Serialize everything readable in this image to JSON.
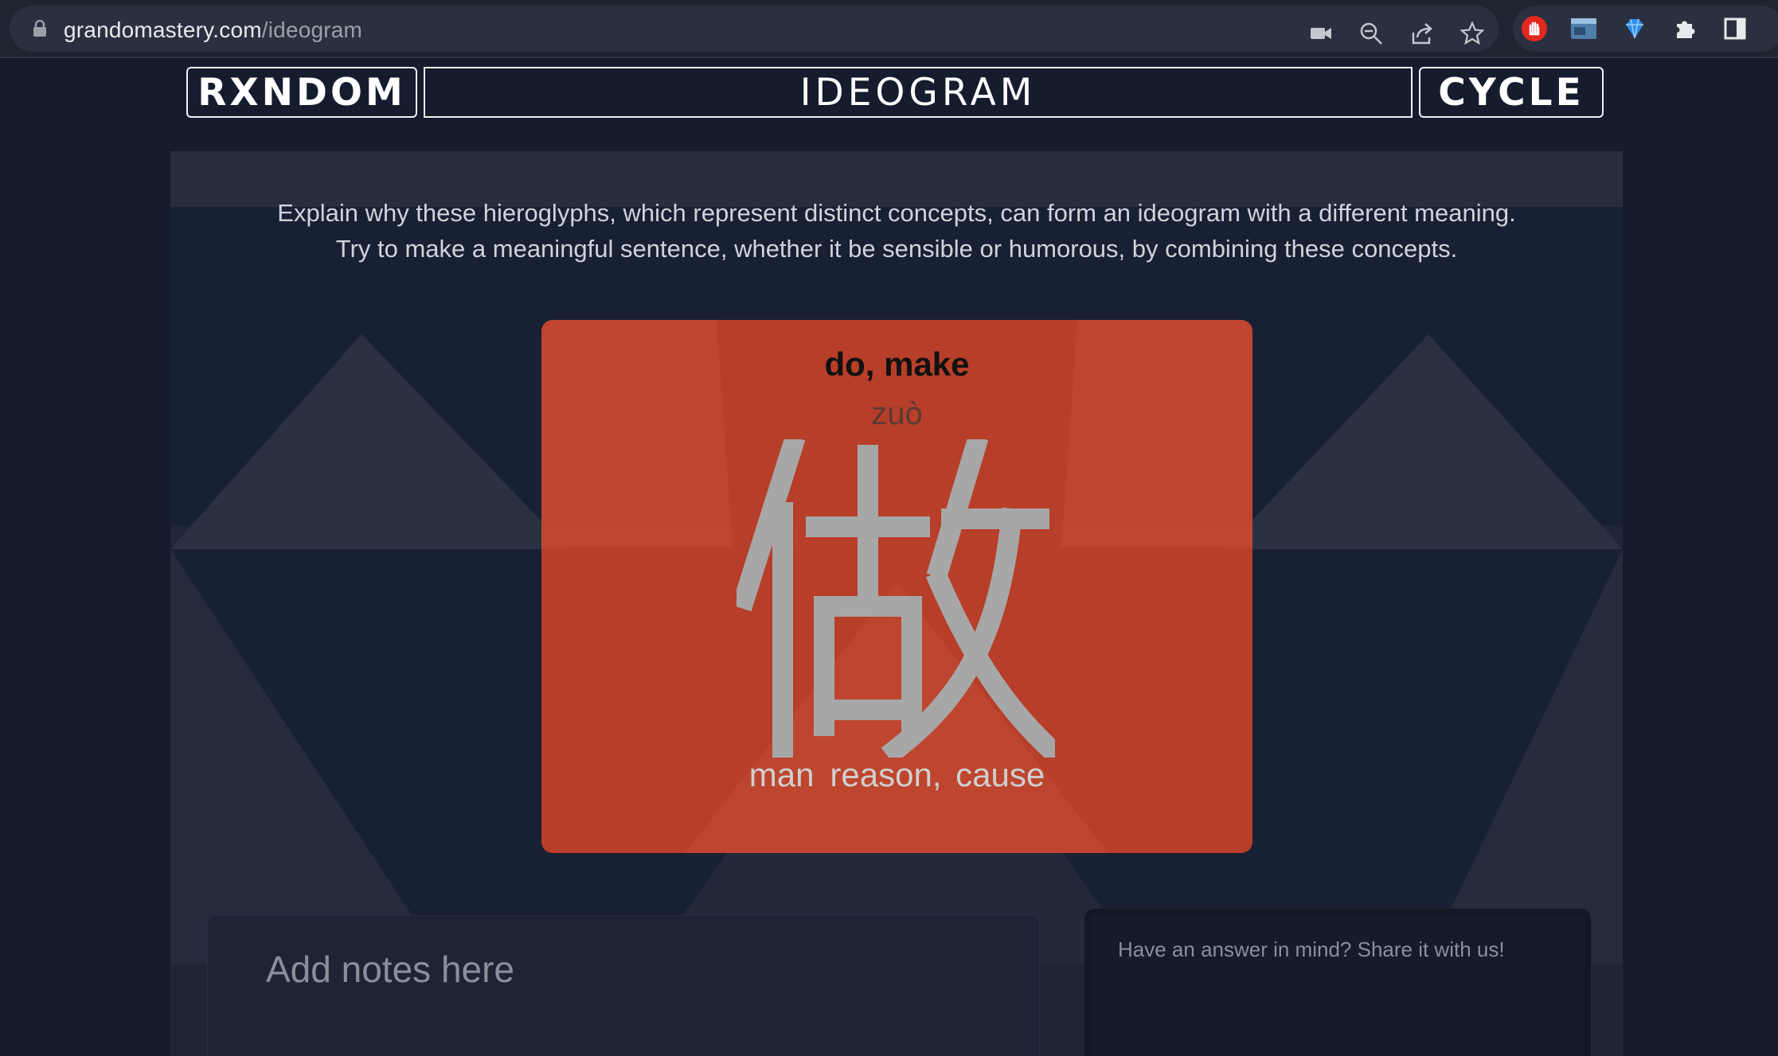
{
  "browser": {
    "url_host": "grandomastery.com",
    "url_path": "/ideogram",
    "toolbar_icons": [
      "camera-icon",
      "zoom-out-icon",
      "share-icon",
      "star-icon"
    ],
    "extension_icons": [
      "adblock-hand-icon",
      "browser-window-icon",
      "diamond-icon",
      "puzzle-piece-icon",
      "side-panel-icon"
    ]
  },
  "header": {
    "left_button": "RXNDOM",
    "title": "IDEOGRAM",
    "right_button": "CYCLE"
  },
  "instructions": {
    "line1": "Explain why these hieroglyphs, which represent distinct concepts, can form an ideogram with a different meaning.",
    "line2": "Try to make a meaningful sentence, whether it be sensible or humorous, by combining these concepts."
  },
  "card": {
    "meaning": "do, make",
    "pinyin": "zuò",
    "character": "做",
    "components": [
      "man",
      "reason, cause"
    ],
    "accent_color": "#d24428"
  },
  "notes": {
    "placeholder": "Add notes here"
  },
  "answer": {
    "placeholder": "Have an answer in mind? Share it with us!"
  }
}
